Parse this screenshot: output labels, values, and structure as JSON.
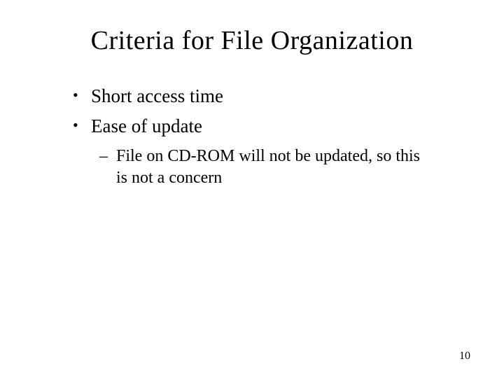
{
  "slide": {
    "title": "Criteria for File Organization",
    "bullets": [
      {
        "text": "Short access time"
      },
      {
        "text": "Ease of update"
      }
    ],
    "subbullets": [
      {
        "text": "File on CD-ROM will not be updated, so this is not a concern"
      }
    ],
    "page_number": "10"
  }
}
